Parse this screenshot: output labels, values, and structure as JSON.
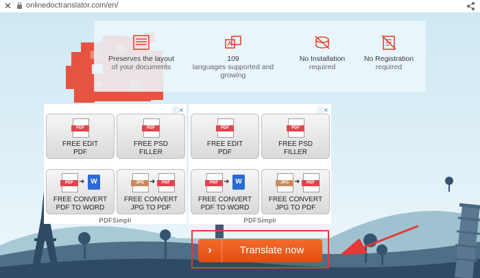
{
  "browser": {
    "url": "onlinedoctranslator.com/en/"
  },
  "features": [
    {
      "icon": "layout-icon",
      "line1": "Preserves the layout",
      "line2": "of your documents"
    },
    {
      "icon": "languages-icon",
      "line1": "109",
      "line2": "languages supported and growing"
    },
    {
      "icon": "no-installation-icon",
      "line1": "No Installation",
      "line2": "required"
    },
    {
      "icon": "no-registration-icon",
      "line1": "No Registration",
      "line2": "required"
    }
  ],
  "ads": [
    {
      "tiles": [
        {
          "label1": "FREE EDIT",
          "label2": "PDF",
          "doc": "PDF"
        },
        {
          "label1": "FREE PSD",
          "label2": "FILLER",
          "doc": "PDF"
        },
        {
          "label1": "FREE CONVERT",
          "label2": "PDF TO WORD",
          "doc": "PDF",
          "target": "W"
        },
        {
          "label1": "FREE CONVERT",
          "label2": "JPG TO PDF",
          "doc": "JPG",
          "target": "PDF"
        }
      ],
      "footer": "PDFSimpli"
    },
    {
      "tiles": [
        {
          "label1": "FREE EDIT",
          "label2": "PDF",
          "doc": "PDF"
        },
        {
          "label1": "FREE PSD",
          "label2": "FILLER",
          "doc": "PDF"
        },
        {
          "label1": "FREE CONVERT",
          "label2": "PDF TO WORD",
          "doc": "PDF",
          "target": "W"
        },
        {
          "label1": "FREE CONVERT",
          "label2": "JPG TO PDF",
          "doc": "JPG",
          "target": "PDF"
        }
      ],
      "footer": "PDFSimpli"
    }
  ],
  "cta": {
    "label": "Translate now",
    "chevron": "›"
  },
  "colors": {
    "accent": "#f05a1e",
    "highlight": "#e53935",
    "sky": "#d9eef6"
  }
}
